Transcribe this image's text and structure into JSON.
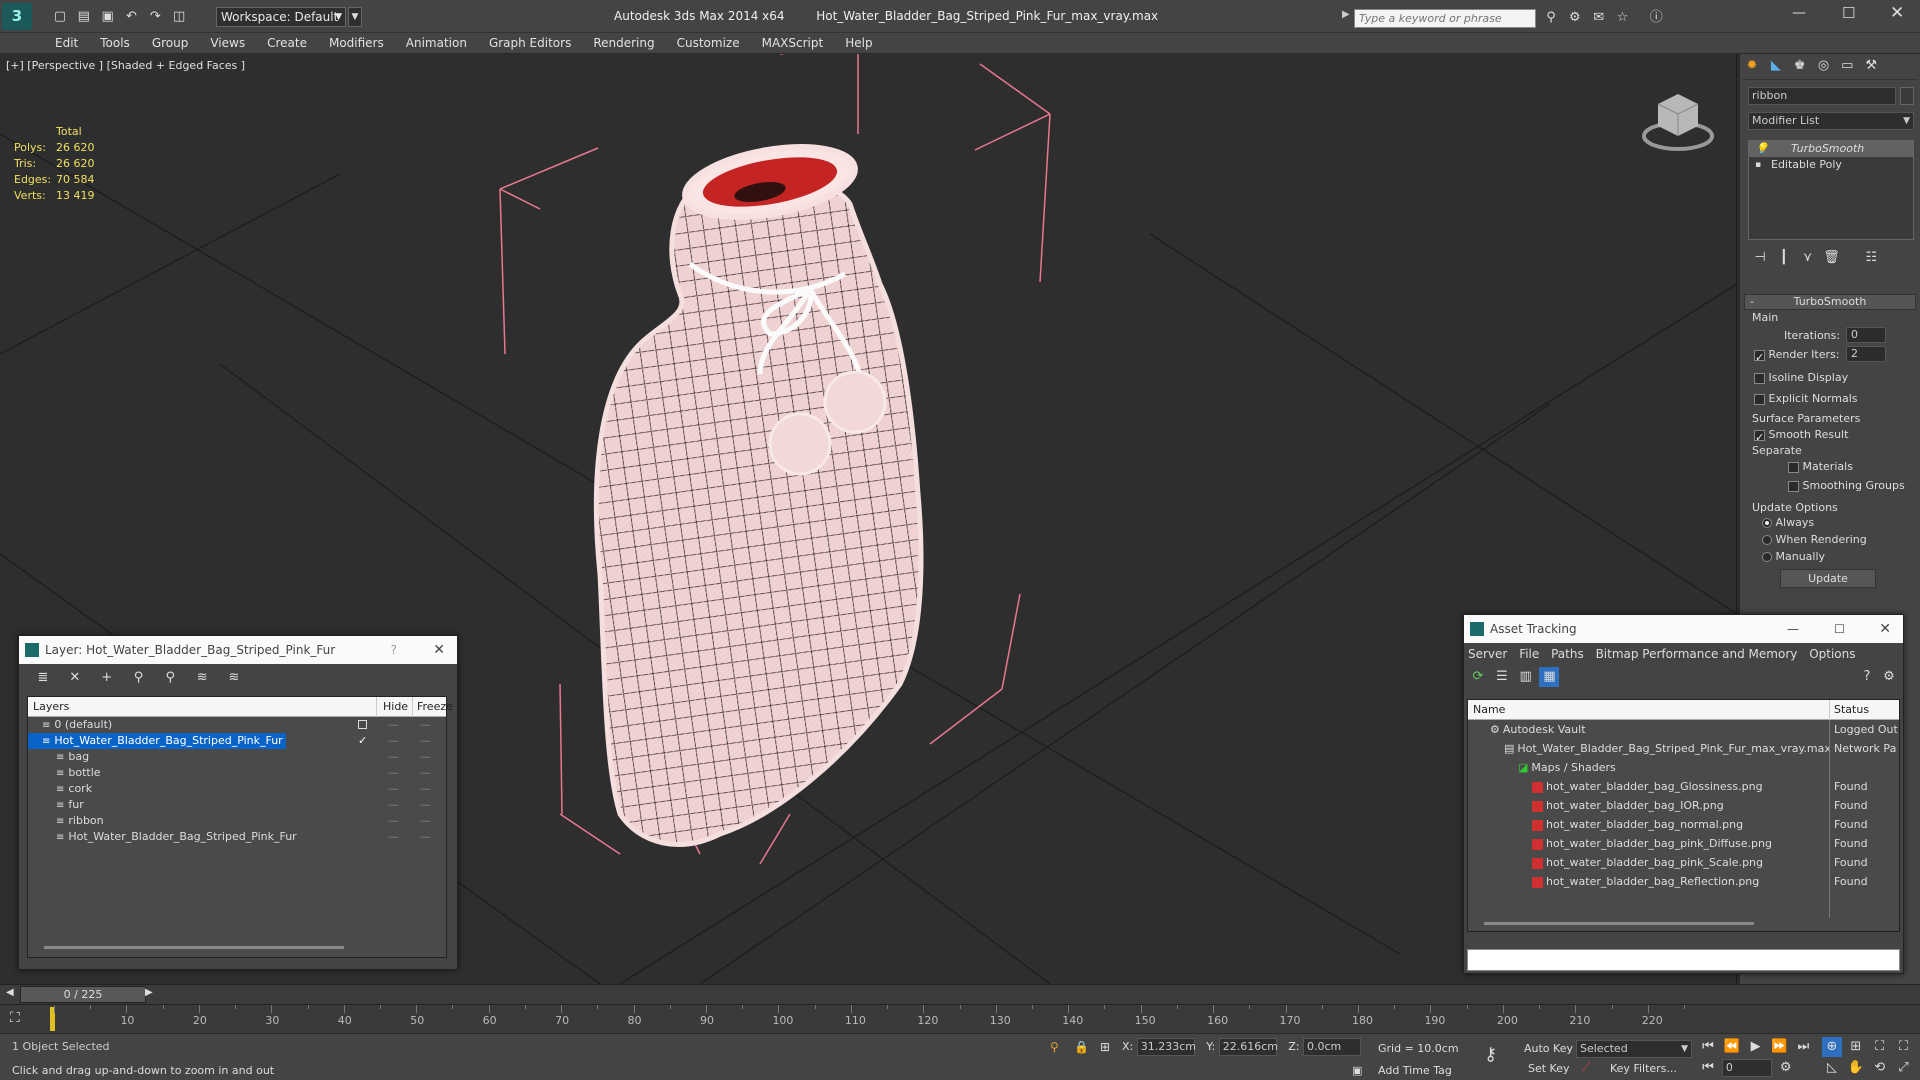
{
  "titlebar": {
    "workspace_label": "Workspace: Default",
    "app_title": "Autodesk 3ds Max  2014 x64",
    "file_title": "Hot_Water_Bladder_Bag_Striped_Pink_Fur_max_vray.max",
    "search_placeholder": "Type a keyword or phrase"
  },
  "menu": [
    "Edit",
    "Tools",
    "Group",
    "Views",
    "Create",
    "Modifiers",
    "Animation",
    "Graph Editors",
    "Rendering",
    "Customize",
    "MAXScript",
    "Help"
  ],
  "viewport": {
    "label": "[+] [Perspective ] [Shaded + Edged Faces ]",
    "stats_header": "Total",
    "stats": [
      {
        "label": "Polys:",
        "value": "26 620"
      },
      {
        "label": "Tris:",
        "value": "26 620"
      },
      {
        "label": "Edges:",
        "value": "70 584"
      },
      {
        "label": "Verts:",
        "value": "13 419"
      }
    ]
  },
  "command_panel": {
    "object_name": "ribbon",
    "modifier_list_label": "Modifier List",
    "stack": [
      "TurboSmooth",
      "Editable Poly"
    ],
    "rollout_title": "TurboSmooth",
    "main_group": "Main",
    "iterations_label": "Iterations:",
    "iterations_value": "0",
    "render_iters_label": "Render Iters:",
    "render_iters_value": "2",
    "isoline_label": "Isoline Display",
    "explicit_normals_label": "Explicit Normals",
    "surface_group": "Surface Parameters",
    "smooth_result_label": "Smooth Result",
    "separate_label": "Separate",
    "materials_label": "Materials",
    "smoothing_groups_label": "Smoothing Groups",
    "update_group": "Update Options",
    "always_label": "Always",
    "when_rendering_label": "When Rendering",
    "manually_label": "Manually",
    "update_button": "Update"
  },
  "layer_window": {
    "title": "Layer: Hot_Water_Bladder_Bag_Striped_Pink_Fur",
    "help": "?",
    "col_layers": "Layers",
    "col_hide": "Hide",
    "col_freeze": "Freeze",
    "rows": [
      {
        "name": "0 (default)",
        "level": 0
      },
      {
        "name": "Hot_Water_Bladder_Bag_Striped_Pink_Fur",
        "level": 0,
        "selected": true
      },
      {
        "name": "bag",
        "level": 1
      },
      {
        "name": "bottle",
        "level": 1
      },
      {
        "name": "cork",
        "level": 1
      },
      {
        "name": "fur",
        "level": 1
      },
      {
        "name": "ribbon",
        "level": 1
      },
      {
        "name": "Hot_Water_Bladder_Bag_Striped_Pink_Fur",
        "level": 1
      }
    ]
  },
  "asset_window": {
    "title": "Asset Tracking",
    "menu": [
      "Server",
      "File",
      "Paths",
      "Bitmap Performance and Memory",
      "Options"
    ],
    "col_name": "Name",
    "col_status": "Status",
    "rows": [
      {
        "name": "Autodesk Vault",
        "status": "Logged Out",
        "level": 1
      },
      {
        "name": "Hot_Water_Bladder_Bag_Striped_Pink_Fur_max_vray.max",
        "status": "Network Pa",
        "level": 2
      },
      {
        "name": "Maps / Shaders",
        "status": "",
        "level": 3
      },
      {
        "name": "hot_water_bladder_bag_Glossiness.png",
        "status": "Found",
        "level": 4
      },
      {
        "name": "hot_water_bladder_bag_IOR.png",
        "status": "Found",
        "level": 4
      },
      {
        "name": "hot_water_bladder_bag_normal.png",
        "status": "Found",
        "level": 4
      },
      {
        "name": "hot_water_bladder_bag_pink_Diffuse.png",
        "status": "Found",
        "level": 4
      },
      {
        "name": "hot_water_bladder_bag_pink_Scale.png",
        "status": "Found",
        "level": 4
      },
      {
        "name": "hot_water_bladder_bag_Reflection.png",
        "status": "Found",
        "level": 4
      }
    ]
  },
  "timeline": {
    "frame_label": "0 / 225",
    "ticks": [
      "10",
      "20",
      "30",
      "40",
      "50",
      "60",
      "70",
      "80",
      "90",
      "100",
      "110",
      "120",
      "130",
      "140",
      "150",
      "160",
      "170",
      "180",
      "190",
      "200",
      "210",
      "220"
    ]
  },
  "status": {
    "selection": "1 Object Selected",
    "prompt": "Click and drag up-and-down to zoom in and out",
    "x_label": "X:",
    "x_value": "31.233cm",
    "y_label": "Y:",
    "y_value": "22.616cm",
    "z_label": "Z:",
    "z_value": "0.0cm",
    "grid": "Grid = 10.0cm",
    "auto_key": "Auto Key",
    "set_key": "Set Key",
    "selected_dropdown": "Selected",
    "key_filters": "Key Filters...",
    "add_time_tag": "Add Time Tag",
    "frame_value": "0"
  },
  "colors": {
    "accent": "#0a64c8",
    "bag_pink": "#f2d0d0",
    "bag_red": "#c02020"
  }
}
